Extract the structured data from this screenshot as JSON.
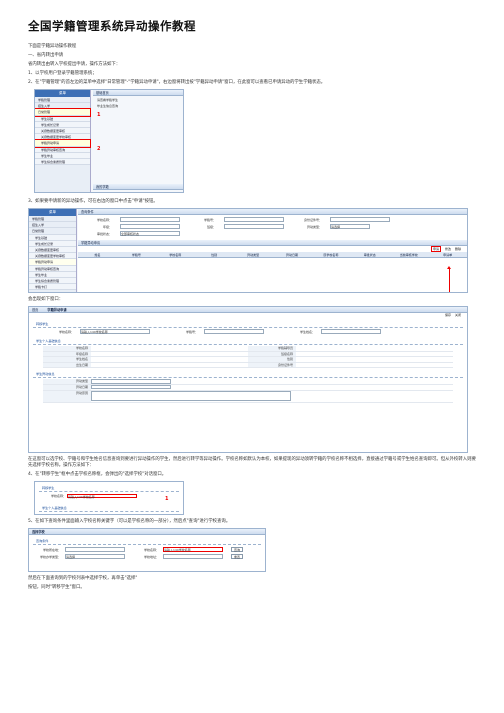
{
  "title": "全国学籍管理系统异动操作教程",
  "paragraphs": {
    "intro": "下面是学籍异动操作教程",
    "sec1": "一、省内转出申请",
    "sec1_desc": "省内转出由转入学校提出申请，操作方法如下：",
    "step1": "1、以学校用户登录学籍管理系统；",
    "step2": "2、在\"学籍管理\"的首左边的菜单中选择\"日常管理\"-\"学籍异动申请\"，右边窗将转出按\"学籍异动申请\"窗口，在此窗可以查看已申请异动的学生学籍状态。",
    "step3": "3、如果要申请新的异动操作，可在右边的窗口中点击\"申请\"按钮。",
    "popup": "会出现如下窗口：",
    "popup_desc": "在这窗可以选学校、学籍号和学生姓名信息查询到要进行异动操作的学生，然后进行转学等异动操作。学校名称如默认为本校，如果提现的异动须转学籍的学校名称不相选择，直接通过学籍号或学生姓名查询即可。但从外校转入则要先选择学校名称。操作方法如下：",
    "step4": "4、在\"转移学生\"框中点击学校名称框，会弹出的\"选择学校\"对话窗口。",
    "step5": "5、在如下查询条件里面输入学校名称关键字（可以是学校名称的一部分），然后点\"查询\"进行学校查询。",
    "final": "然后在下面查询到的学校列表中选择学校，再单击\"选择\"",
    "final2": "按钮，同时\"转移学生\"窗口。"
  },
  "menu": {
    "header": "菜单",
    "items": [
      "学籍管理",
      "招生入学",
      "日常管理",
      "学生基础",
      "学生成长记录",
      "关键数据变更审核",
      "关键数据变更学校审核",
      "学籍异动申请",
      "学籍异动审核查询",
      "学生毕业",
      "学生综合素质管理",
      "学籍卡打"
    ]
  },
  "shot1": {
    "tabs": [
      "基础首页",
      "我的学籍"
    ],
    "notes": [
      "请查看学籍学生",
      "毕业生信息查询"
    ],
    "markers": [
      "1",
      "2"
    ]
  },
  "shot2": {
    "search_bar": "查询条件",
    "fields": [
      "学校名称：",
      "学籍号：",
      "身份证件号：",
      "年级：",
      "班级：",
      "异动类型：",
      "审批状态："
    ],
    "type_value": "请选择",
    "status_value": "全部审核状态",
    "list_title": "学籍异动申请",
    "columns": [
      "姓名",
      "学籍号",
      "学校名称",
      "性别",
      "异动类型",
      "异动日期",
      "原学校名称",
      "审批状态",
      "当前审核学校",
      "申请单"
    ],
    "buttons": [
      "申请",
      "修改",
      "删除"
    ]
  },
  "shot3": {
    "tabs": [
      "首页",
      "学籍异动申请"
    ],
    "toolbar": [
      "保存",
      "关闭"
    ],
    "sec_move": "转移学生",
    "move_fields": [
      "学校名称：",
      "学籍号：",
      "学生姓名："
    ],
    "school_value": "请输入140学校名称",
    "sec_info": "学生个人基础信息",
    "info_left": [
      "学校名称",
      "年级名称",
      "学生姓名",
      "出生日期"
    ],
    "info_right": [
      "学籍辅导员",
      "班级名称",
      "性别",
      "身份证件号"
    ],
    "sec_change": "学生异动信息",
    "change_fields": [
      "异动类型",
      "异动日期",
      "异动原因"
    ]
  },
  "shot4": {
    "sec_move": "转移学生",
    "school_label": "学校名称：",
    "school_value": "请输入140学校名称",
    "sec_info": "学生个人基础信息",
    "marker": "1"
  },
  "shot5": {
    "title": "选择学校",
    "bar": "查询条件",
    "fields": [
      "学校所在地：",
      "学校名称：",
      "学校办学类型：",
      "学校地址："
    ],
    "name_value": "请输入140学校名称",
    "type_value": "请选择",
    "buttons": [
      "查询",
      "重置"
    ]
  }
}
